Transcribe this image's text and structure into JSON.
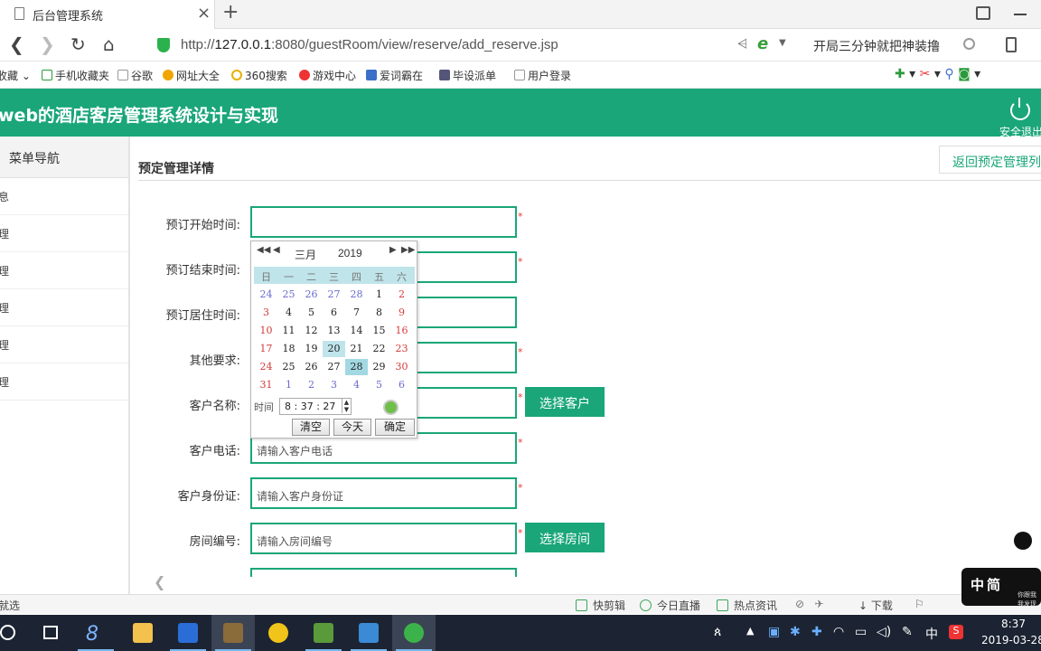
{
  "browser": {
    "tab_title": "后台管理系统",
    "tab_close": "×",
    "new_tab": "+",
    "url_prefix": "http://",
    "url_host": "127.0.0.1",
    "url_rest": ":8080/guestRoom/view/reserve/add_reserve.jsp",
    "search_text": "开局三分钟就把神装撸",
    "bookmarks": [
      "收藏",
      "手机收藏夹",
      "谷歌",
      "网址大全",
      "360搜索",
      "游戏中心",
      "爱词霸在",
      "毕设派单",
      "用户登录"
    ]
  },
  "app": {
    "title": "web的酒店客房管理系统设计与实现",
    "logout_label": "安全退出"
  },
  "sidebar": {
    "header": "菜单导航",
    "items": [
      "息",
      "理",
      "理",
      "理",
      "理",
      "理"
    ]
  },
  "main": {
    "title": "预定管理详情",
    "back_button": "返回预定管理列表"
  },
  "form": {
    "fields": [
      {
        "label": "预订开始时间:",
        "value": "",
        "required": "*"
      },
      {
        "label": "预订结束时间:",
        "value": "",
        "required": "*"
      },
      {
        "label": "预订居住时间:",
        "value": "",
        "required": ""
      },
      {
        "label": "其他要求:",
        "value": "",
        "required": "*"
      },
      {
        "label": "客户名称:",
        "value": "",
        "required": "*",
        "button": "选择客户"
      },
      {
        "label": "客户电话:",
        "placeholder": "请输入客户电话",
        "required": "*"
      },
      {
        "label": "客户身份证:",
        "placeholder": "请输入客户身份证",
        "required": "*"
      },
      {
        "label": "房间编号:",
        "placeholder": "请输入房间编号",
        "required": "*",
        "button": "选择房间"
      }
    ]
  },
  "calendar": {
    "month": "三月",
    "year": "2019",
    "weekdays": [
      "日",
      "一",
      "二",
      "三",
      "四",
      "五",
      "六"
    ],
    "weeks": [
      [
        "24",
        "25",
        "26",
        "27",
        "28",
        "1",
        "2"
      ],
      [
        "3",
        "4",
        "5",
        "6",
        "7",
        "8",
        "9"
      ],
      [
        "10",
        "11",
        "12",
        "13",
        "14",
        "15",
        "16"
      ],
      [
        "17",
        "18",
        "19",
        "20",
        "21",
        "22",
        "23"
      ],
      [
        "24",
        "25",
        "26",
        "27",
        "28",
        "29",
        "30"
      ],
      [
        "31",
        "1",
        "2",
        "3",
        "4",
        "5",
        "6"
      ]
    ],
    "time_label": "时间",
    "time_value": "8 : 37 : 27",
    "buttons": [
      "清空",
      "今天",
      "确定"
    ]
  },
  "statusbar": {
    "left": "就选",
    "items": [
      "快剪辑",
      "今日直播",
      "热点资讯",
      "下载"
    ]
  },
  "watermark": {
    "logo": "中简",
    "text": "你跟我我发现"
  },
  "taskbar": {
    "time": "8:37",
    "date": "2019-03-28",
    "ime": "中"
  },
  "colors": {
    "accent": "#1aa679",
    "required": "#e33",
    "calendar_header": "#bfe4ea"
  }
}
